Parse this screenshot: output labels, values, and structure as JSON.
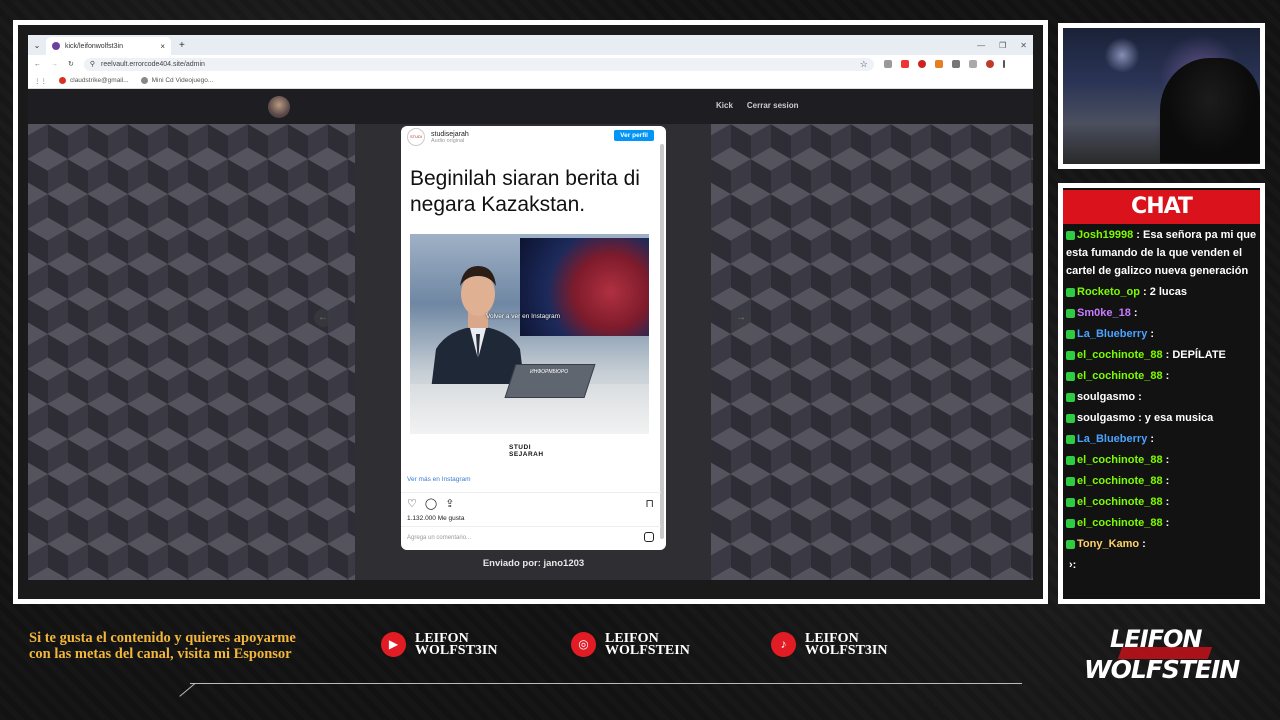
{
  "browser": {
    "tab_title": "kick/leifonwolfst3in",
    "url": "reelvault.errorcode404.site/admin",
    "bookmarks": [
      "claudstrike@gmail...",
      "Mini Cd Videojuego..."
    ]
  },
  "site": {
    "nav": [
      "Kick",
      "Cerrar sesion"
    ],
    "prev_arrow": "←",
    "next_arrow": "→",
    "sent_by": "Enviado por: jano1203"
  },
  "post": {
    "account": "studisejarah",
    "audio": "Audio original",
    "view_profile": "Ver perfil",
    "headline": "Beginilah siaran berita di negara Kazakstan.",
    "video_overlay": "Volver a ver en Instagram",
    "video_screen_text": "ИНФОРМБЮРО",
    "brand_top": "STUDI",
    "brand_bottom": "SEJARAH",
    "more": "Ver más en Instagram",
    "likes": "1.132.000 Me gusta",
    "comment_placeholder": "Agrega un comentario..."
  },
  "chat": {
    "title": "CHAT",
    "messages": [
      {
        "user": "Josh19998",
        "text": ": Esa señora pa mi que esta fumando de la que venden el cartel de galizco nueva generación",
        "color": "#7CFC00"
      },
      {
        "user": "Rocketo_op",
        "text": ": 2 lucas",
        "color": "#7CFC00"
      },
      {
        "user": "Sm0ke_18",
        "text": ":",
        "color": "#c77dff"
      },
      {
        "user": "La_Blueberry",
        "text": ":",
        "color": "#4aa3ff"
      },
      {
        "user": "el_cochinote_88",
        "text": ": DEPÍLATE",
        "color": "#7CFC00"
      },
      {
        "user": "el_cochinote_88",
        "text": ":",
        "color": "#7CFC00"
      },
      {
        "user": "soulgasmo",
        "text": ":",
        "color": "#ffffff"
      },
      {
        "user": "soulgasmo",
        "text": ": y esa musica",
        "color": "#ffffff"
      },
      {
        "user": "La_Blueberry",
        "text": ":",
        "color": "#4aa3ff"
      },
      {
        "user": "el_cochinote_88",
        "text": ":",
        "color": "#7CFC00"
      },
      {
        "user": "el_cochinote_88",
        "text": ":",
        "color": "#7CFC00"
      },
      {
        "user": "el_cochinote_88",
        "text": ":",
        "color": "#7CFC00"
      },
      {
        "user": "el_cochinote_88",
        "text": ":",
        "color": "#7CFC00"
      },
      {
        "user": "Tony_Kamo",
        "text": ":",
        "color": "#ffd166"
      },
      {
        "user": "",
        "text": "›:",
        "color": "#ffffff"
      }
    ]
  },
  "overlay": {
    "sponsor_text": "Si te gusta el contenido y quieres apoyarme con las metas del canal, visita mi Esponsor",
    "socials": [
      {
        "platform": "youtube",
        "icon": "youtube-icon",
        "line1": "LEIFON",
        "line2": "WOLFST3IN"
      },
      {
        "platform": "instagram",
        "icon": "instagram-icon",
        "line1": "LEIFON",
        "line2": "WOLFSTEIN"
      },
      {
        "platform": "tiktok",
        "icon": "tiktok-icon",
        "line1": "LEIFON",
        "line2": "WOLFST3IN"
      }
    ],
    "brand_line1": "LEIFON",
    "brand_line2": "WOLFSTEIN"
  },
  "colors": {
    "accent_red": "#d9121b",
    "sponsor_gold": "#f2b73a",
    "insta_blue": "#0095f6"
  }
}
